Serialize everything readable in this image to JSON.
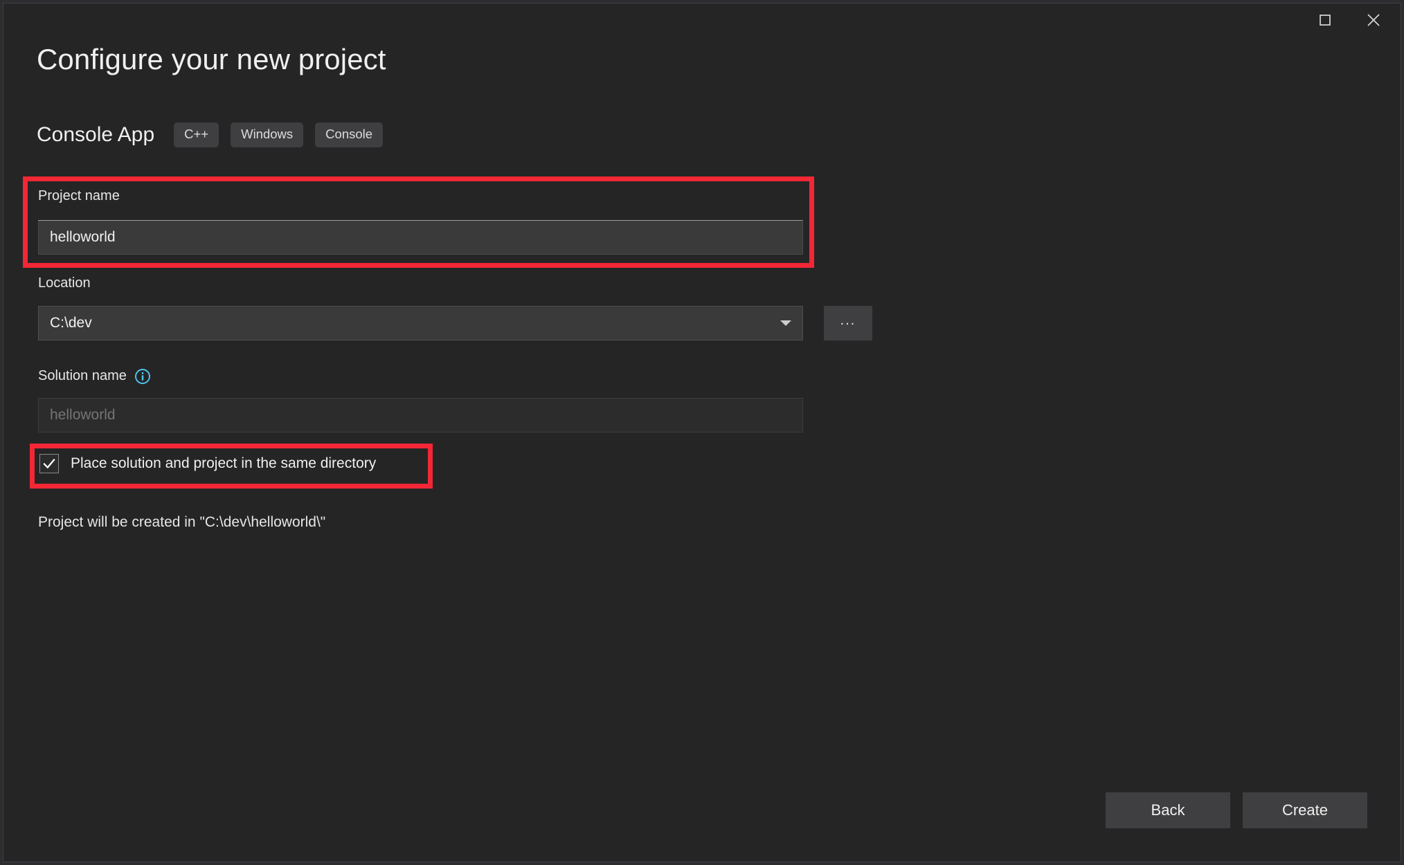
{
  "window": {
    "maximize_label": "Maximize",
    "close_label": "Close"
  },
  "header": {
    "title": "Configure your new project",
    "template_name": "Console App",
    "tags": [
      "C++",
      "Windows",
      "Console"
    ]
  },
  "form": {
    "project_name": {
      "label": "Project name",
      "value": "helloworld"
    },
    "location": {
      "label": "Location",
      "value": "C:\\dev",
      "browse_label": "...",
      "dropdown_icon": "chevron-down-icon"
    },
    "solution_name": {
      "label": "Solution name",
      "value": "",
      "placeholder": "helloworld",
      "info_icon": "info-icon"
    },
    "same_directory_checkbox": {
      "label": "Place solution and project in the same directory",
      "checked": true,
      "check_glyph": "✓"
    },
    "status": "Project will be created in \"C:\\dev\\helloworld\\\""
  },
  "footer": {
    "back_label": "Back",
    "create_label": "Create"
  },
  "annotations": {
    "highlight_color": "#f32735",
    "boxes": [
      "project-name-field",
      "same-directory-checkbox"
    ]
  },
  "colors": {
    "background": "#252526",
    "input_background": "#3a3a3a",
    "disabled_input_background": "#2c2c2c",
    "button_background": "#3f3f41",
    "info_accent": "#4ec9f0"
  }
}
